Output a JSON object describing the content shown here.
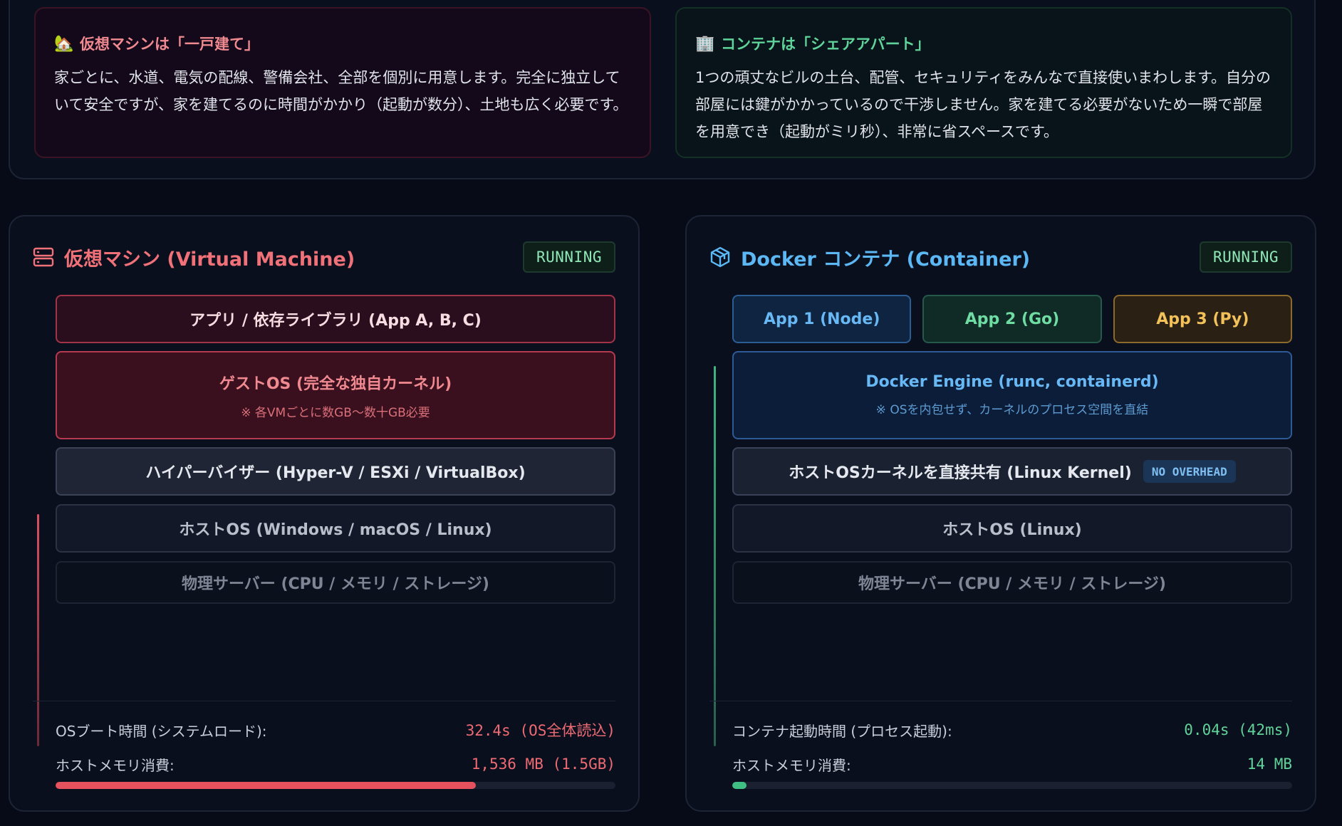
{
  "analogy": {
    "vm": {
      "icon": "house-icon",
      "title": "仮想マシンは「一戸建て」",
      "text": "家ごとに、水道、電気の配線、警備会社、全部を個別に用意します。完全に独立していて安全ですが、家を建てるのに時間がかかり（起動が数分）、土地も広く必要です。"
    },
    "container": {
      "icon": "office-building-icon",
      "title": "コンテナは「シェアアパート」",
      "text": "1つの頑丈なビルの土台、配管、セキュリティをみんなで直接使いまわします。自分の部屋には鍵がかかっているので干渉しません。家を建てる必要がないため一瞬で部屋を用意でき（起動がミリ秒）、非常に省スペースです。"
    }
  },
  "vm_panel": {
    "icon": "server-icon",
    "title": "仮想マシン (Virtual Machine)",
    "status": "RUNNING",
    "layers": {
      "app": "アプリ / 依存ライブラリ (App A, B, C)",
      "guest_os": "ゲストOS (完全な独自カーネル)",
      "guest_os_note": "※ 各VMごとに数GB〜数十GB必要",
      "hypervisor": "ハイパーバイザー (Hyper-V / ESXi / VirtualBox)",
      "host_os": "ホストOS (Windows / macOS / Linux)",
      "physical": "物理サーバー (CPU / メモリ / ストレージ)"
    },
    "boot_label": "OSブート時間 (システムロード):",
    "boot_value": "32.4s (OS全体読込)",
    "memory_label": "ホストメモリ消費:",
    "memory_value": "1,536 MB (1.5GB)",
    "memory_fraction": 0.75,
    "accent_color": "#e5525e"
  },
  "container_panel": {
    "icon": "cube-icon",
    "title": "Docker コンテナ (Container)",
    "status": "RUNNING",
    "apps": [
      "App 1 (Node)",
      "App 2 (Go)",
      "App 3 (Py)"
    ],
    "layers": {
      "engine": "Docker Engine (runc, containerd)",
      "engine_note": "※ OSを内包せず、カーネルのプロセス空間を直結",
      "kernel": "ホストOSカーネルを直接共有 (Linux Kernel)",
      "kernel_badge": "NO OVERHEAD",
      "host_os": "ホストOS (Linux)",
      "physical": "物理サーバー (CPU / メモリ / ストレージ)"
    },
    "boot_label": "コンテナ起動時間 (プロセス起動):",
    "boot_value": "0.04s (42ms)",
    "memory_label": "ホストメモリ消費:",
    "memory_value": "14 MB",
    "memory_fraction": 0.025,
    "accent_color": "#3fbf83"
  }
}
